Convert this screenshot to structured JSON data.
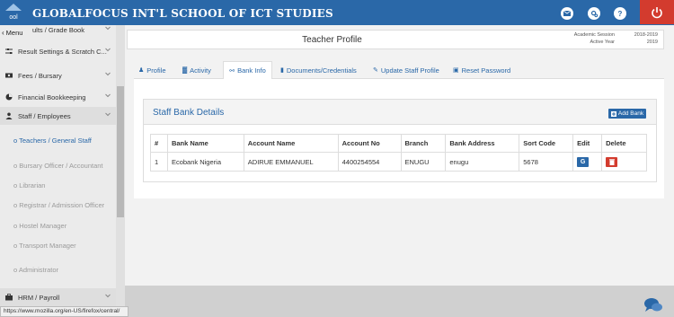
{
  "topbar": {
    "logo_text": "ool",
    "school_name": "GLOBALFOCUS INT'L SCHOOL OF ICT STUDIES",
    "icons": [
      "mail-icon",
      "settings-icon",
      "help-icon",
      "power-icon"
    ],
    "help_glyph": "?"
  },
  "sidebar": {
    "menu_toggle": "Menu",
    "items": [
      {
        "label": "ults / Grade Book",
        "icon": "gradebook-icon"
      },
      {
        "label": "Result Settings & Scratch C...",
        "icon": "sliders-icon"
      },
      {
        "label": "Fees / Bursary",
        "icon": "money-icon"
      },
      {
        "label": "Financial Bookkeeping",
        "icon": "pie-chart-icon"
      },
      {
        "label": "Staff / Employees",
        "icon": "user-icon"
      }
    ],
    "subitems": [
      {
        "label": "Teachers / General Staff",
        "active": true
      },
      {
        "label": "Bursary Officer / Accountant",
        "active": false
      },
      {
        "label": "Librarian",
        "active": false
      },
      {
        "label": "Registrar / Admission Officer",
        "active": false
      },
      {
        "label": "Hostel Manager",
        "active": false
      },
      {
        "label": "Transport Manager",
        "active": false
      },
      {
        "label": "Administrator",
        "active": false
      }
    ],
    "bottom_item": {
      "label": "HRM / Payroll",
      "icon": "briefcase-icon"
    }
  },
  "status_url": "https://www.mozilla.org/en-US/firefox/central/",
  "page": {
    "title": "Teacher Profile",
    "session_label": "Academic Session",
    "session_value": "2018-2019",
    "active_year_label": "Active Year",
    "active_year_value": "2019"
  },
  "tabs": [
    {
      "label": "Profile",
      "icon": "user-icon",
      "glyph": "♟",
      "active": false
    },
    {
      "label": "Activity",
      "icon": "chart-icon",
      "glyph": "▓",
      "active": false
    },
    {
      "label": "Bank Info",
      "icon": "link-icon",
      "glyph": "⚯",
      "active": true
    },
    {
      "label": "Documents/Credentials",
      "icon": "file-icon",
      "glyph": "▮",
      "active": false
    },
    {
      "label": "Update Staff Profile",
      "icon": "edit-icon",
      "glyph": "✎",
      "active": false
    },
    {
      "label": "Reset Password",
      "icon": "lock-icon",
      "glyph": "▣",
      "active": false
    }
  ],
  "bank_panel": {
    "title": "Staff Bank Details",
    "add_button": "Add Bank",
    "columns": [
      "#",
      "Bank Name",
      "Account Name",
      "Account No",
      "Branch",
      "Bank Address",
      "Sort Code",
      "Edit",
      "Delete"
    ],
    "rows": [
      {
        "num": "1",
        "bank_name": "Ecobank Nigeria",
        "account_name": "ADIRUE EMMANUEL",
        "account_no": "4400254554",
        "branch": "ENUGU",
        "address": "enugu",
        "sort_code": "5678"
      }
    ],
    "edit_glyph": "G"
  },
  "colors": {
    "brand": "#2a68a8",
    "danger": "#d33b2e",
    "sidebar_bg": "#ebebeb"
  }
}
